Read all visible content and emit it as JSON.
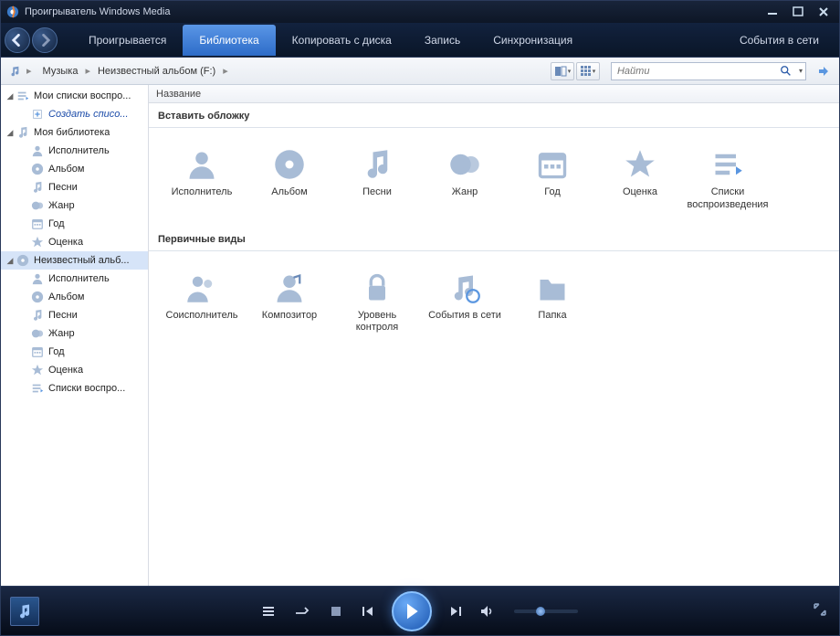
{
  "app": {
    "title": "Проигрыватель Windows Media"
  },
  "tabs": {
    "items": [
      {
        "label": "Проигрывается",
        "active": false
      },
      {
        "label": "Библиотека",
        "active": true
      },
      {
        "label": "Копировать с диска",
        "active": false
      },
      {
        "label": "Запись",
        "active": false
      },
      {
        "label": "Синхронизация",
        "active": false
      }
    ],
    "right": {
      "label": "События в сети"
    }
  },
  "breadcrumb": {
    "items": [
      {
        "label": "Музыка"
      },
      {
        "label": "Неизвестный альбом (F:)"
      }
    ]
  },
  "search": {
    "placeholder": "Найти"
  },
  "column_header": "Название",
  "sidebar": {
    "items": [
      {
        "label": "Мои списки воспро...",
        "depth": 0,
        "expanded": true,
        "icon": "playlist"
      },
      {
        "label": "Создать списо...",
        "depth": 1,
        "italic": true,
        "icon": "create"
      },
      {
        "label": "Моя библиотека",
        "depth": 0,
        "expanded": true,
        "icon": "note"
      },
      {
        "label": "Исполнитель",
        "depth": 1,
        "icon": "artist"
      },
      {
        "label": "Альбом",
        "depth": 1,
        "icon": "album"
      },
      {
        "label": "Песни",
        "depth": 1,
        "icon": "songs"
      },
      {
        "label": "Жанр",
        "depth": 1,
        "icon": "genre"
      },
      {
        "label": "Год",
        "depth": 1,
        "icon": "year"
      },
      {
        "label": "Оценка",
        "depth": 1,
        "icon": "rating"
      },
      {
        "label": "Неизвестный альб...",
        "depth": 0,
        "expanded": true,
        "selected": true,
        "icon": "disc"
      },
      {
        "label": "Исполнитель",
        "depth": 1,
        "icon": "artist"
      },
      {
        "label": "Альбом",
        "depth": 1,
        "icon": "album"
      },
      {
        "label": "Песни",
        "depth": 1,
        "icon": "songs"
      },
      {
        "label": "Жанр",
        "depth": 1,
        "icon": "genre"
      },
      {
        "label": "Год",
        "depth": 1,
        "icon": "year"
      },
      {
        "label": "Оценка",
        "depth": 1,
        "icon": "rating"
      },
      {
        "label": "Списки воспро...",
        "depth": 1,
        "icon": "playlist"
      }
    ]
  },
  "sections": [
    {
      "title": "Вставить обложку",
      "items": [
        {
          "label": "Исполнитель",
          "icon": "artist"
        },
        {
          "label": "Альбом",
          "icon": "album"
        },
        {
          "label": "Песни",
          "icon": "songs"
        },
        {
          "label": "Жанр",
          "icon": "genre"
        },
        {
          "label": "Год",
          "icon": "year"
        },
        {
          "label": "Оценка",
          "icon": "rating"
        },
        {
          "label": "Списки воспроизведения",
          "icon": "playlist"
        }
      ]
    },
    {
      "title": "Первичные виды",
      "items": [
        {
          "label": "Соисполнитель",
          "icon": "coartist"
        },
        {
          "label": "Композитор",
          "icon": "composer"
        },
        {
          "label": "Уровень контроля",
          "icon": "lock"
        },
        {
          "label": "События в сети",
          "icon": "online"
        },
        {
          "label": "Папка",
          "icon": "folder"
        }
      ]
    }
  ]
}
